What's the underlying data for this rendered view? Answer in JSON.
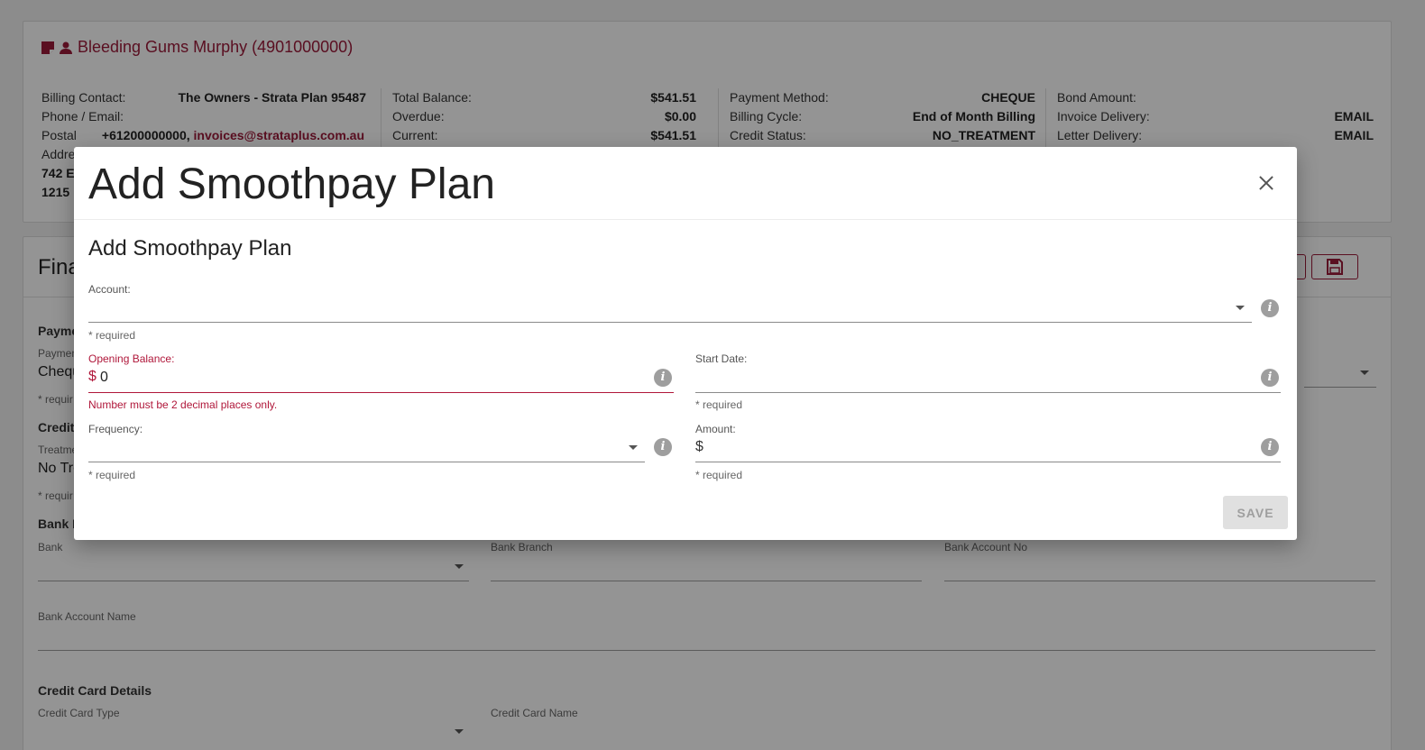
{
  "customer": {
    "name": "Bleeding Gums Murphy (4901000000)",
    "billing_contact_label": "Billing Contact:",
    "billing_contact": "The Owners - Strata Plan 95487",
    "phone_email_label": "Phone / Email:",
    "postal_label": "Postal",
    "address_label": "Addre",
    "phone": "+61200000000,",
    "email": "invoices@strataplus.com.au",
    "addr_line1": "742 E",
    "addr_line2": "1215",
    "total_balance_label": "Total Balance:",
    "total_balance": "$541.51",
    "overdue_label": "Overdue:",
    "overdue": "$0.00",
    "current_label": "Current:",
    "current": "$541.51",
    "payment_method_label": "Payment Method:",
    "payment_method": "CHEQUE",
    "billing_cycle_label": "Billing Cycle:",
    "billing_cycle": "End of Month Billing",
    "credit_status_label": "Credit Status:",
    "credit_status": "NO_TREATMENT",
    "bond_amount_label": "Bond Amount:",
    "invoice_delivery_label": "Invoice Delivery:",
    "invoice_delivery": "EMAIL",
    "letter_delivery_label": "Letter Delivery:",
    "letter_delivery": "EMAIL"
  },
  "financial": {
    "title": "Fina",
    "payment_section": "Payme",
    "payment_label": "Paymen",
    "payment_value": "Chequ",
    "required": "* requir",
    "credit_section": "Credit",
    "treatment_label": "Treatme",
    "treatment_value": "No Tre",
    "bank_section": "Bank D",
    "bank_label": "Bank",
    "bank_branch_label": "Bank Branch",
    "bank_account_no_label": "Bank Account No",
    "bank_account_name_label": "Bank Account Name",
    "cc_section": "Credit Card Details",
    "cc_type_label": "Credit Card Type",
    "cc_name_label": "Credit Card Name"
  },
  "modal": {
    "title": "Add Smoothpay Plan",
    "form_title": "Add Smoothpay Plan",
    "account_label": "Account:",
    "account_help": "* required",
    "opening_balance_label": "Opening Balance:",
    "opening_balance_prefix": "$",
    "opening_balance_value": "0",
    "opening_balance_error": "Number must be 2 decimal places only.",
    "start_date_label": "Start Date:",
    "start_date_help": "* required",
    "frequency_label": "Frequency:",
    "frequency_help": "* required",
    "amount_label": "Amount:",
    "amount_prefix": "$",
    "amount_help": "* required",
    "save_label": "SAVE"
  },
  "colors": {
    "brand": "#9b1a3a",
    "error": "#b0173a",
    "backdrop": "rgba(0,0,0,0.42)"
  },
  "icons": [
    "note-icon",
    "person-icon",
    "save-icon",
    "close-icon",
    "info-icon",
    "chevron-down-icon"
  ]
}
